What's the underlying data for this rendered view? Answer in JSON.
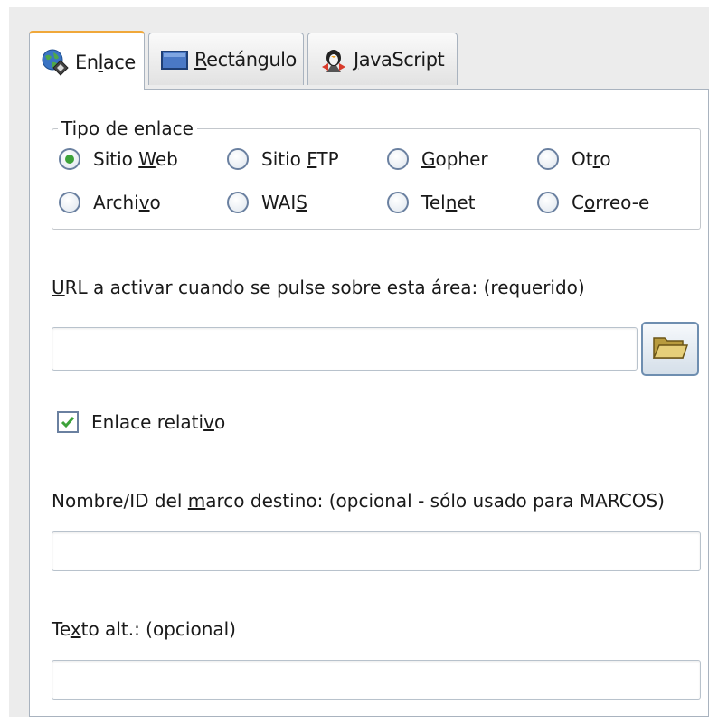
{
  "tabs": [
    {
      "label_pre": "En",
      "label_mn": "l",
      "label_post": "ace",
      "icon": "globe-link-icon",
      "active": true
    },
    {
      "label_pre": "",
      "label_mn": "R",
      "label_post": "ectángulo",
      "icon": "rectangle-icon",
      "active": false
    },
    {
      "label_pre": "",
      "label_mn": "J",
      "label_post": "avaScript",
      "icon": "javascript-icon",
      "active": false
    }
  ],
  "link_type": {
    "legend": "Tipo de enlace",
    "options": [
      {
        "pre": "Sitio ",
        "mn": "W",
        "post": "eb",
        "selected": true
      },
      {
        "pre": "Sitio ",
        "mn": "F",
        "post": "TP",
        "selected": false
      },
      {
        "pre": "",
        "mn": "G",
        "post": "opher",
        "selected": false
      },
      {
        "pre": "Ot",
        "mn": "r",
        "post": "o",
        "selected": false
      },
      {
        "pre": "Archi",
        "mn": "v",
        "post": "o",
        "selected": false
      },
      {
        "pre": "WAI",
        "mn": "S",
        "post": "",
        "selected": false
      },
      {
        "pre": "Tel",
        "mn": "n",
        "post": "et",
        "selected": false
      },
      {
        "pre": "C",
        "mn": "o",
        "post": "rreo-e",
        "selected": false
      }
    ]
  },
  "url": {
    "label_mn": "U",
    "label_post": "RL a activar cuando se pulse sobre esta área: (requerido)",
    "value": "",
    "browse_icon": "folder-open-icon"
  },
  "relative": {
    "pre": "Enlace relati",
    "mn": "v",
    "post": "o",
    "checked": true
  },
  "target": {
    "pre": "Nombre/ID del ",
    "mn": "m",
    "post": "arco destino: (opcional - sólo usado para MARCOS)",
    "value": ""
  },
  "alt": {
    "pre": "Te",
    "mn": "x",
    "post": "to alt.: (opcional)",
    "value": ""
  },
  "colors": {
    "accent_tab": "#f0a83a",
    "radio_selected": "#3da23a",
    "border": "#a9b3bf"
  }
}
